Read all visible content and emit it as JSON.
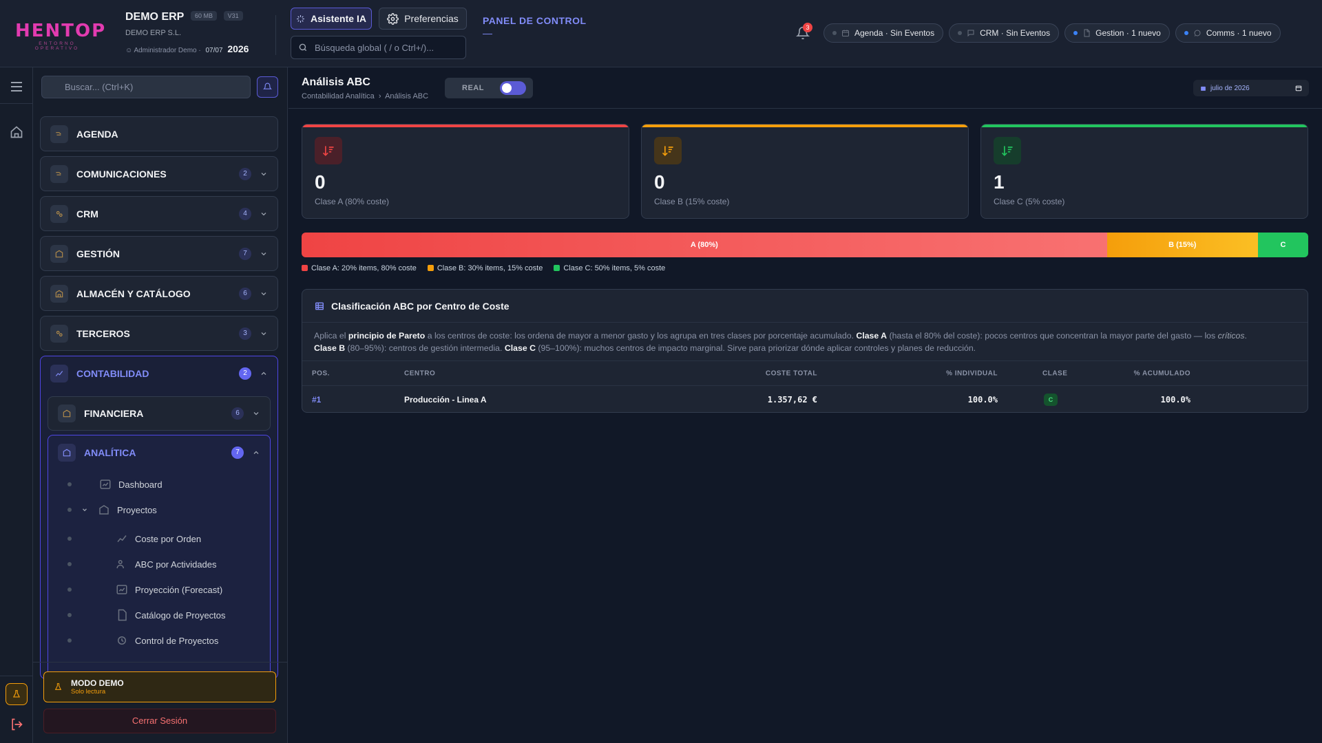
{
  "header": {
    "logo_text": "HENTOP",
    "logo_sub": "ENTORNO OPERATIVO",
    "company_name": "DEMO ERP",
    "chip_size": "60 MB",
    "chip_version": "V31",
    "company_legal": "DEMO ERP S.L.",
    "user": "Administrador Demo",
    "date": "07/07",
    "year": "2026",
    "ai_button": "Asistente IA",
    "prefs_button": "Preferencias",
    "search_placeholder": "Búsqueda global ( / o Ctrl+/)...",
    "panel_title": "PANEL DE CONTROL",
    "panel_dash": "—",
    "notifications_count": "3",
    "status_pills": [
      {
        "label": "Agenda · Sin Eventos",
        "active": false
      },
      {
        "label": "CRM · Sin Eventos",
        "active": false
      },
      {
        "label": "Gestion · 1 nuevo",
        "active": true
      },
      {
        "label": "Comms · 1 nuevo",
        "active": true
      }
    ]
  },
  "sidebar": {
    "search_placeholder": "Buscar... (Ctrl+K)",
    "items": [
      {
        "label": "AGENDA",
        "count": ""
      },
      {
        "label": "COMUNICACIONES",
        "count": "2"
      },
      {
        "label": "CRM",
        "count": "4"
      },
      {
        "label": "GESTIÓN",
        "count": "7"
      },
      {
        "label": "ALMACÉN Y CATÁLOGO",
        "count": "6"
      },
      {
        "label": "TERCEROS",
        "count": "3"
      }
    ],
    "contabilidad": {
      "label": "CONTABILIDAD",
      "count": "2"
    },
    "financiera": {
      "label": "FINANCIERA",
      "count": "6"
    },
    "analitica": {
      "label": "ANALÍTICA",
      "count": "7"
    },
    "analitica_items": [
      "Dashboard",
      "Proyectos",
      "Coste por Orden",
      "ABC por Actividades",
      "Proyección (Forecast)",
      "Catálogo de Proyectos",
      "Control de Proyectos"
    ],
    "demo_title": "MODO DEMO",
    "demo_sub": "Solo lectura",
    "logout": "Cerrar Sesión"
  },
  "page": {
    "title": "Análisis ABC",
    "breadcrumb_parent": "Contabilidad Analítica",
    "breadcrumb_current": "Análisis ABC",
    "mode_label": "REAL",
    "date_value": "julio de 2026"
  },
  "stats": [
    {
      "value": "0",
      "label": "Clase A (80% coste)",
      "color": "#ef4444"
    },
    {
      "value": "0",
      "label": "Clase B (15% coste)",
      "color": "#f59e0b"
    },
    {
      "value": "1",
      "label": "Clase C (5% coste)",
      "color": "#22c55e"
    }
  ],
  "abc_bar": {
    "segments": [
      {
        "label": "A (80%)",
        "share": 80
      },
      {
        "label": "B (15%)",
        "share": 15
      },
      {
        "label": "C",
        "share": 5
      }
    ],
    "legend": [
      "Clase A: 20% items, 80% coste",
      "Clase B: 30% items, 15% coste",
      "Clase C: 50% items, 5% coste"
    ]
  },
  "table": {
    "title": "Clasificación ABC por Centro de Coste",
    "desc": {
      "t1": "Aplica el ",
      "b1": "principio de Pareto",
      "t2": " a los centros de coste: los ordena de mayor a menor gasto y los agrupa en tres clases por porcentaje acumulado. ",
      "b2": "Clase A",
      "t3": " (hasta el 80% del coste): pocos centros que concentran la mayor parte del gasto — los ",
      "i1": "críticos",
      "t4": ".",
      "b3": "Clase B",
      "t5": " (80–95%): centros de gestión intermedia. ",
      "b4": "Clase C",
      "t6": " (95–100%): muchos centros de impacto marginal. Sirve para priorizar dónde aplicar controles y planes de reducción."
    },
    "columns": [
      "POS.",
      "CENTRO",
      "COSTE TOTAL",
      "% INDIVIDUAL",
      "% ACUMULADO",
      "CLASE"
    ],
    "rows": [
      {
        "pos": "#1",
        "centro": "Producción - Linea A",
        "coste": "1.357,62 €",
        "individual": "100.0%",
        "acumulado": "100.0%",
        "clase": "C"
      }
    ]
  }
}
